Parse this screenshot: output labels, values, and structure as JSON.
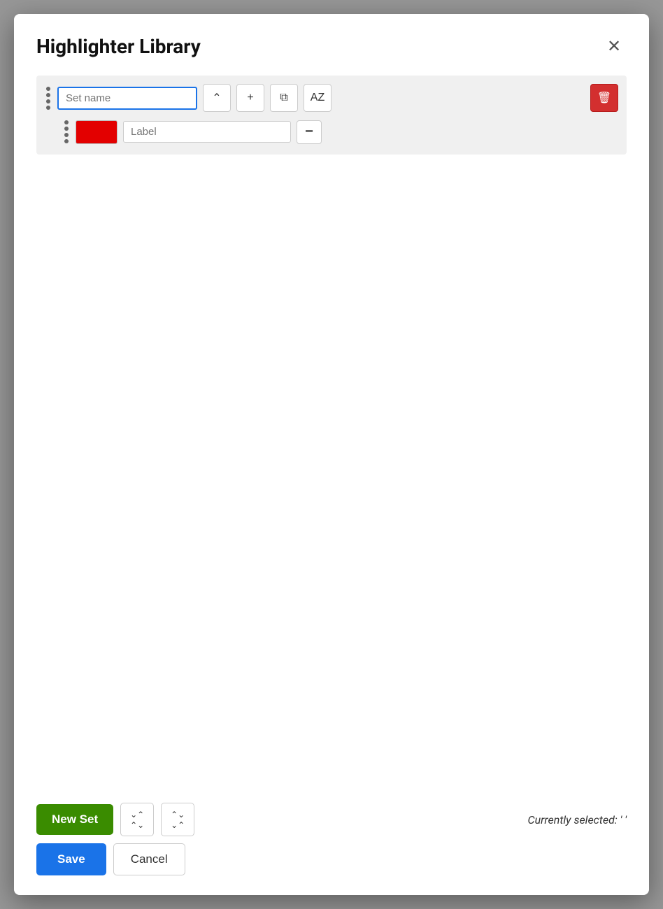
{
  "modal": {
    "title": "Highlighter Library",
    "close_label": "×"
  },
  "toolbar": {
    "set_name_placeholder": "Set name",
    "sort_label": "AZ",
    "add_label": "+",
    "duplicate_label": "⧉",
    "delete_label": "🗑"
  },
  "highlighter_row": {
    "color": "#e30000",
    "label_placeholder": "Label",
    "remove_label": "−"
  },
  "footer": {
    "new_set_label": "New Set",
    "collapse_all_label": "collapse all",
    "expand_label": "expand",
    "currently_selected_label": "Currently selected:",
    "currently_selected_value": "' '",
    "save_label": "Save",
    "cancel_label": "Cancel"
  }
}
